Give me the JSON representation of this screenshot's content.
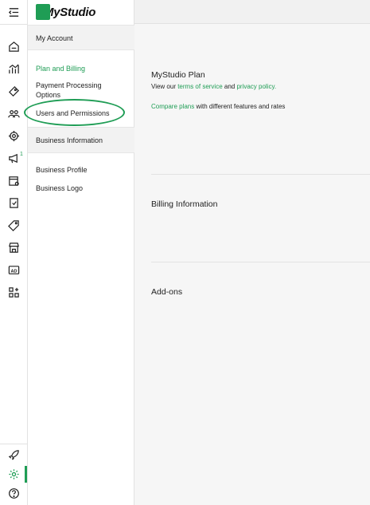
{
  "brand": {
    "name": "MyStudio"
  },
  "account_section": {
    "header": "My Account",
    "links": [
      "Plan and Billing",
      "Payment Processing Options",
      "Users and Permissions"
    ]
  },
  "business_section": {
    "header": "Business Information",
    "links": [
      "Business Profile",
      "Business Logo"
    ]
  },
  "rail": {
    "badge": "1"
  },
  "main": {
    "plan_title": "MyStudio Plan",
    "plan_text_prefix": "View our ",
    "terms_link": "terms of service",
    "and_text": " and ",
    "privacy_link": "privacy policy",
    "period": ".",
    "compare_link": "Compare plans",
    "compare_suffix": " with different features and rates",
    "billing_title": "Billing Information",
    "addons_title": "Add-ons"
  },
  "colors": {
    "accent": "#1f9d55"
  }
}
